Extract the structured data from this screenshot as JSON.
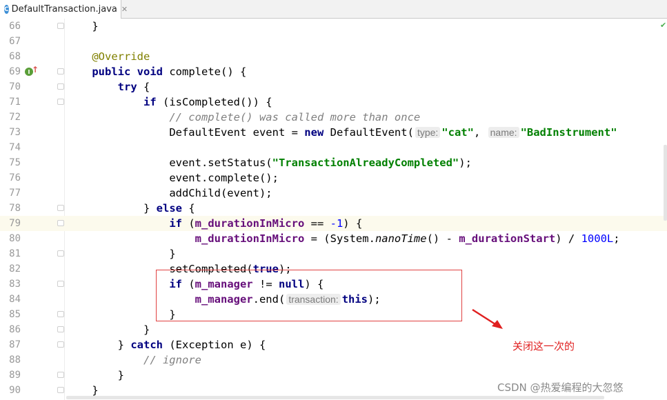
{
  "tab": {
    "icon_letter": "C",
    "filename": "DefaultTransaction.java",
    "close": "✕"
  },
  "gutter": {
    "override_icon_letter": "I",
    "override_arrow": "↑"
  },
  "status": {
    "check": "✔"
  },
  "colors": {
    "keyword": "#000080",
    "string": "#008000",
    "field": "#660e7a",
    "annotation_box": "#e04040"
  },
  "code": {
    "l66": {
      "n": "66",
      "t": "    }"
    },
    "l67": {
      "n": "67"
    },
    "l68": {
      "n": "68",
      "a": "@Override"
    },
    "l69": {
      "n": "69",
      "k1": "public",
      "k2": "void",
      "t": " complete() {"
    },
    "l70": {
      "n": "70",
      "k": "try",
      "t": " {"
    },
    "l71": {
      "n": "71",
      "k": "if",
      "t": " (isCompleted()) {"
    },
    "l72": {
      "n": "72",
      "c": "// complete() was called more than once"
    },
    "l73": {
      "n": "73",
      "t1": "DefaultEvent event = ",
      "k": "new",
      "t2": " DefaultEvent(",
      "h1": "type:",
      "s1": "\"cat\"",
      "t3": ", ",
      "h2": "name:",
      "s2": "\"BadInstrument\""
    },
    "l74": {
      "n": "74"
    },
    "l75": {
      "n": "75",
      "t1": "event.setStatus(",
      "s": "\"TransactionAlreadyCompleted\"",
      "t2": ");"
    },
    "l76": {
      "n": "76",
      "t": "event.complete();"
    },
    "l77": {
      "n": "77",
      "t": "addChild(event);"
    },
    "l78": {
      "n": "78",
      "t1": "} ",
      "k": "else",
      "t2": " {"
    },
    "l79": {
      "n": "79",
      "k": "if",
      "t1": " (",
      "f": "m_durationInMicro",
      "t2": " == ",
      "num": "-1",
      "t3": ") {"
    },
    "l80": {
      "n": "80",
      "f1": "m_durationInMicro",
      "t1": " = (System.",
      "i": "nanoTime",
      "t2": "() - ",
      "f2": "m_durationStart",
      "t3": ") / ",
      "num": "1000L",
      "t4": ";"
    },
    "l81": {
      "n": "81",
      "t": "}"
    },
    "l82": {
      "n": "82",
      "t1": "setCompleted(",
      "k": "true",
      "t2": ");"
    },
    "l83": {
      "n": "83",
      "k1": "if",
      "t1": " (",
      "f": "m_manager",
      "t2": " != ",
      "k2": "null",
      "t3": ") {"
    },
    "l84": {
      "n": "84",
      "f": "m_manager",
      "t1": ".end(",
      "h": "transaction:",
      "k": "this",
      "t2": ");"
    },
    "l85": {
      "n": "85",
      "t": "}"
    },
    "l86": {
      "n": "86",
      "t": "}"
    },
    "l87": {
      "n": "87",
      "t1": "} ",
      "k": "catch",
      "t2": " (Exception e) {"
    },
    "l88": {
      "n": "88",
      "c": "// ignore"
    },
    "l89": {
      "n": "89",
      "t": "}"
    },
    "l90": {
      "n": "90",
      "t": "}"
    }
  },
  "annotation": {
    "note": "关闭这一次的"
  },
  "watermark": "CSDN @热爱编程的大忽悠"
}
